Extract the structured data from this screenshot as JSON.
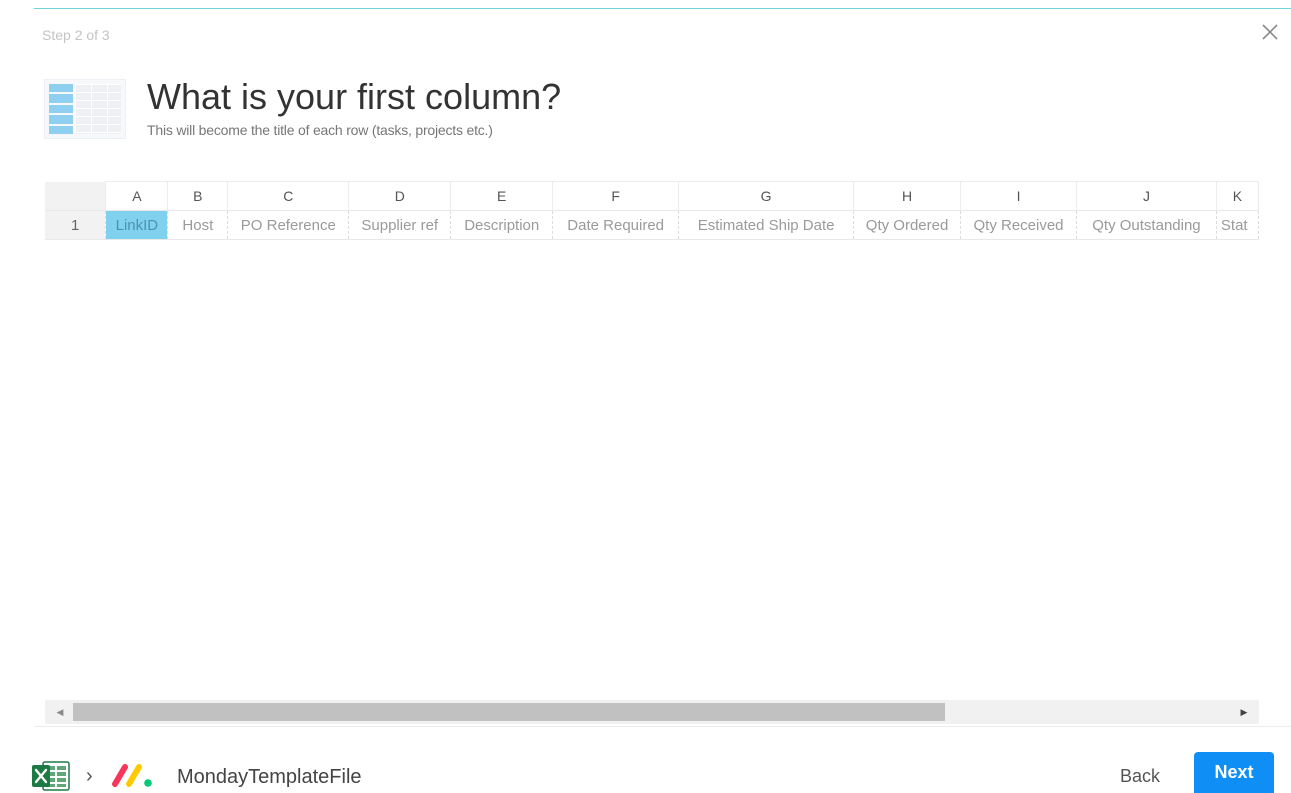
{
  "wizard": {
    "step_label": "Step 2 of 3",
    "title": "What is your first column?",
    "subtitle": "This will become the title of each row (tasks, projects etc.)",
    "close_icon": "close-icon"
  },
  "sheet": {
    "column_letters": [
      "A",
      "B",
      "C",
      "D",
      "E",
      "F",
      "G",
      "H",
      "I",
      "J",
      "K"
    ],
    "row_number": "1",
    "cells": [
      "LinkID",
      "Host",
      "PO Reference",
      "Supplier ref",
      "Description",
      "Date Required",
      "Estimated Ship Date",
      "Qty Ordered",
      "Qty Received",
      "Qty Outstanding",
      "Stat"
    ],
    "selected_column": "A",
    "selected_color": "#7fd1ee"
  },
  "scrollbar": {
    "left_arrow": "◀",
    "right_arrow": "▶"
  },
  "footer": {
    "source_icon": "excel-icon",
    "target_icon": "monday-logo-icon",
    "separator": "›",
    "file_name": "MondayTemplateFile",
    "back_label": "Back",
    "next_label": "Next",
    "accent_color": "#0f8ff5"
  }
}
